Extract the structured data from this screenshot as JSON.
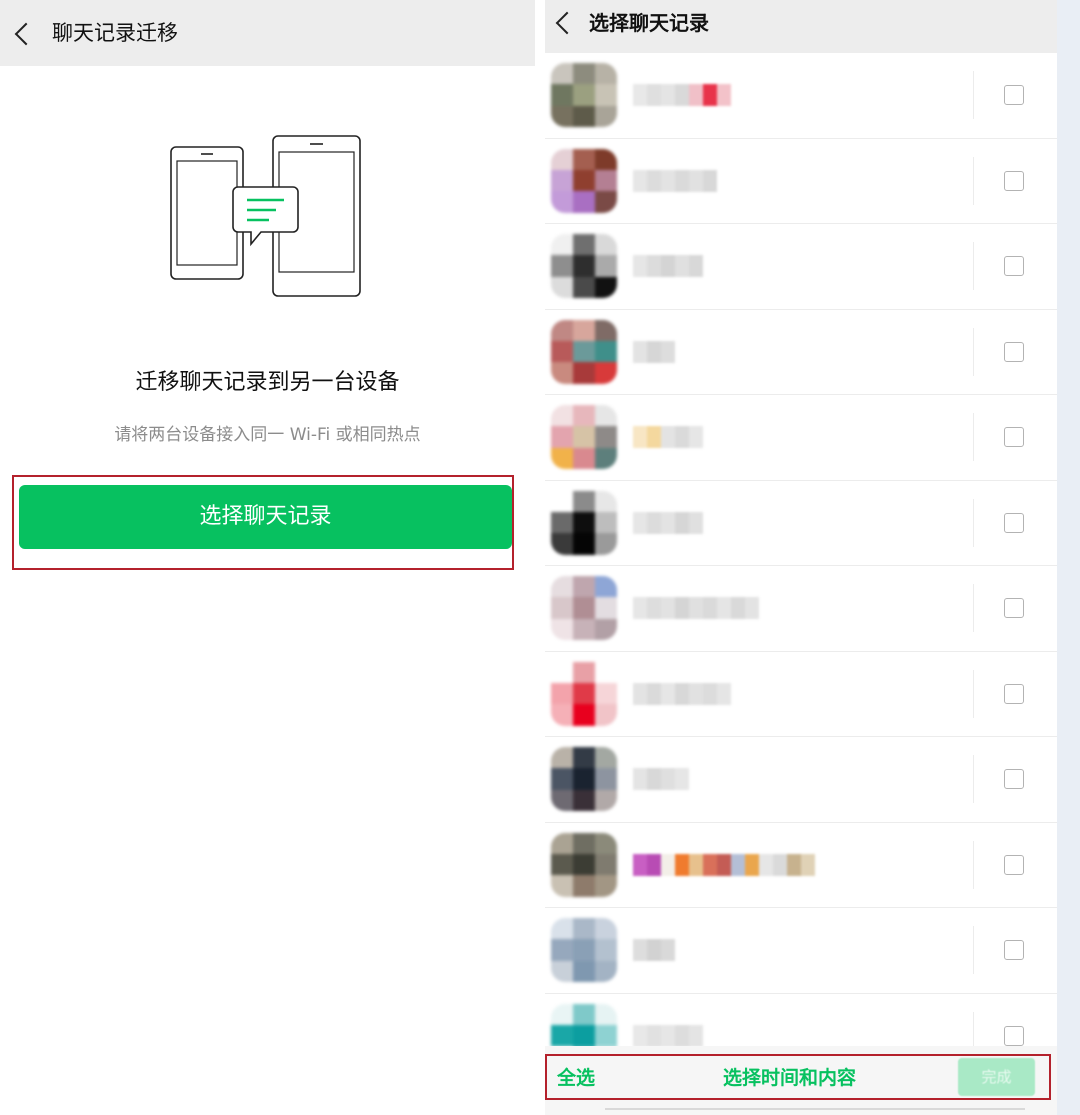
{
  "left_panel": {
    "header": {
      "title": "聊天记录迁移"
    },
    "headline": "迁移聊天记录到另一台设备",
    "hint": "请将两台设备接入同一 Wi-Fi 或相同热点",
    "select_button": {
      "label": "选择聊天记录"
    },
    "colors": {
      "accent": "#07c160",
      "highlight_border": "#b4212c"
    }
  },
  "right_panel": {
    "header": {
      "title": "选择聊天记录"
    },
    "chat_rows": [
      {
        "avatar_colors": [
          "#c9c5bd",
          "#8d8c7e",
          "#b7b2a6",
          "#6f7760",
          "#9ba080",
          "#c8c3b5",
          "#77715f",
          "#5e5b4a",
          "#a9a498"
        ],
        "name_blocks": [
          "#e8e8e8",
          "#dfdfdf",
          "#e4e4e4",
          "#d9d9d9",
          "#f0c0c8",
          "#e8334a",
          "#f3c2c9"
        ]
      },
      {
        "avatar_colors": [
          "#e5d0d5",
          "#a45f50",
          "#7e3b2a",
          "#c7a3d6",
          "#8f3f2f",
          "#b47f93",
          "#c39bd9",
          "#a96fc2",
          "#7a4a46"
        ],
        "name_blocks": [
          "#e6e6e6",
          "#dcdcdc",
          "#e3e3e3",
          "#dadada",
          "#e1e1e1",
          "#d8d8d8"
        ]
      },
      {
        "avatar_colors": [
          "#f0f0f0",
          "#6f6f6f",
          "#d9d9d9",
          "#8e8e8e",
          "#2e2e2e",
          "#aaaaaa",
          "#dcdcdc",
          "#4a4a4a",
          "#111111"
        ],
        "name_blocks": [
          "#e6e6e6",
          "#dcdcdc",
          "#d4d4d4",
          "#e0e0e0",
          "#d8d8d8"
        ]
      },
      {
        "avatar_colors": [
          "#c08884",
          "#d7a69c",
          "#7f6b66",
          "#b85a5a",
          "#6b9a9a",
          "#3f8f8a",
          "#c98a7f",
          "#a83a3a",
          "#d83a3a"
        ],
        "name_blocks": [
          "#e3e3e3",
          "#d6d6d6",
          "#dddddd"
        ]
      },
      {
        "avatar_colors": [
          "#f2e1e3",
          "#e7b7bc",
          "#e6e6e6",
          "#e3a4ae",
          "#d6c3a6",
          "#8e8a88",
          "#f1b24a",
          "#d9898f",
          "#5d7f7c"
        ],
        "name_blocks": [
          "#f8e6c4",
          "#f4d89e",
          "#e3e3e3",
          "#dadada",
          "#e6e6e6"
        ]
      },
      {
        "avatar_colors": [
          "#ffffff",
          "#8b8b8b",
          "#e7e7e7",
          "#6a6a6a",
          "#0e0e0e",
          "#bdbdbd",
          "#3a3a3a",
          "#050505",
          "#9a9a9a"
        ],
        "name_blocks": [
          "#e6e6e6",
          "#dcdcdc",
          "#e3e3e3",
          "#d6d6d6",
          "#e0e0e0"
        ]
      },
      {
        "avatar_colors": [
          "#e6dde0",
          "#bfa6ae",
          "#8ea6d6",
          "#d8c7ca",
          "#b08e94",
          "#e3dde1",
          "#efe3e6",
          "#c7b2b8",
          "#b2a0a6"
        ],
        "name_blocks": [
          "#e6e6e6",
          "#dddddd",
          "#e2e2e2",
          "#d5d5d5",
          "#e0e0e0",
          "#dadada",
          "#e5e5e5",
          "#d9d9d9",
          "#e3e3e3"
        ]
      },
      {
        "avatar_colors": [
          "#ffffff",
          "#e8a0a6",
          "#ffffff",
          "#f3a3ab",
          "#e03a48",
          "#f6d5d8",
          "#f5b0b7",
          "#e8001e",
          "#f1c4c8"
        ],
        "name_blocks": [
          "#e3e3e3",
          "#dadada",
          "#e6e6e6",
          "#d8d8d8",
          "#e1e1e1",
          "#dcdcdc",
          "#e5e5e5"
        ]
      },
      {
        "avatar_colors": [
          "#b9b2a8",
          "#333b46",
          "#a3a8a2",
          "#4b5564",
          "#1a2330",
          "#8d94a0",
          "#6e6a72",
          "#3a3038",
          "#b1a9a8"
        ],
        "name_blocks": [
          "#e4e4e4",
          "#d8d8d8",
          "#dfdfdf",
          "#e6e6e6"
        ]
      },
      {
        "avatar_colors": [
          "#aaa393",
          "#6f6e62",
          "#8b8a7a",
          "#5b5a4e",
          "#3c3d34",
          "#7f7b6f",
          "#c9c1b3",
          "#8e7b6b",
          "#a29684"
        ],
        "name_blocks": [
          "#c85fc3",
          "#b84cb4",
          "#f3efe8",
          "#f07b2e",
          "#e7c18d",
          "#d9705a",
          "#c45c55",
          "#b4bfd6",
          "#eaa64d",
          "#e6e6e6",
          "#dadada",
          "#c7b28e",
          "#e0d2b6"
        ]
      },
      {
        "avatar_colors": [
          "#d9e1ea",
          "#aab8c8",
          "#c9d2de",
          "#96a8bd",
          "#8aa0b6",
          "#b3c1cf",
          "#c8d0d9",
          "#7f98b0",
          "#a3b3c4"
        ],
        "name_blocks": [
          "#dddddd",
          "#d2d2d2",
          "#d9d9d9"
        ]
      },
      {
        "avatar_colors": [
          "#e9f5f5",
          "#7fc9c9",
          "#e6f3f3",
          "#1aa7a7",
          "#0c9ea0",
          "#8ed2d2",
          "#d8eeee",
          "#5ab9bb",
          "#c7e8e8"
        ],
        "name_blocks": [
          "#e8e8e8",
          "#e1e1e1",
          "#e6e6e6",
          "#dddddd",
          "#e4e4e4"
        ]
      }
    ],
    "footer": {
      "select_all_label": "全选",
      "select_time_label": "选择时间和内容",
      "done_label": "完成"
    },
    "colors": {
      "accent": "#07c160",
      "done_disabled": "#a9e9c6",
      "highlight_border": "#b4212c"
    }
  },
  "icons": {
    "back_icon": "chevron-left",
    "illustration": "two-phones-with-chat-bubble",
    "checkbox": "square-outline"
  }
}
